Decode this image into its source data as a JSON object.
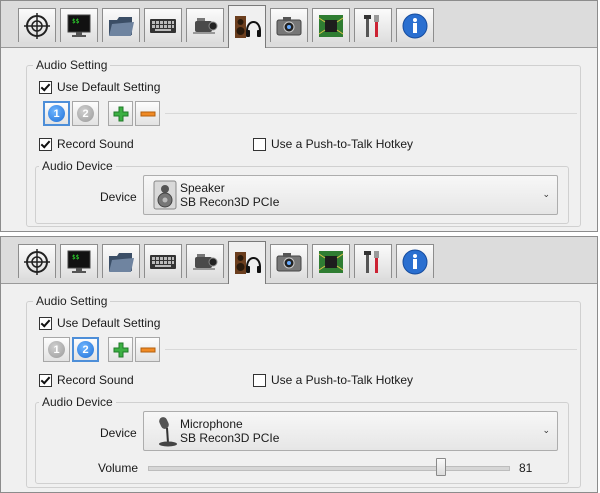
{
  "tabs": [
    {
      "name": "crosshair-icon"
    },
    {
      "name": "monitor-icon"
    },
    {
      "name": "folder-icon"
    },
    {
      "name": "keyboard-icon"
    },
    {
      "name": "camcorder-icon"
    },
    {
      "name": "speaker-headphones-icon"
    },
    {
      "name": "camera-icon"
    },
    {
      "name": "chip-board-icon"
    },
    {
      "name": "tools-icon"
    },
    {
      "name": "info-icon"
    }
  ],
  "active_tab_index": 5,
  "panels": [
    {
      "group_title": "Audio Setting",
      "use_default_label": "Use Default Setting",
      "use_default_checked": true,
      "device_buttons": [
        {
          "label": "1",
          "selected": true
        },
        {
          "label": "2",
          "selected": false
        }
      ],
      "record_sound_label": "Record Sound",
      "record_sound_checked": true,
      "push_to_talk_label": "Use a Push-to-Talk Hotkey",
      "push_to_talk_checked": false,
      "device_group_title": "Audio Device",
      "device_label": "Device",
      "device_name": "Speaker",
      "device_model": "SB Recon3D PCIe",
      "device_icon": "speaker-icon"
    },
    {
      "group_title": "Audio Setting",
      "use_default_label": "Use Default Setting",
      "use_default_checked": true,
      "device_buttons": [
        {
          "label": "1",
          "selected": false
        },
        {
          "label": "2",
          "selected": true
        }
      ],
      "record_sound_label": "Record Sound",
      "record_sound_checked": true,
      "push_to_talk_label": "Use a Push-to-Talk Hotkey",
      "push_to_talk_checked": false,
      "device_group_title": "Audio Device",
      "device_label": "Device",
      "device_name": "Microphone",
      "device_model": "SB Recon3D PCIe",
      "device_icon": "microphone-icon",
      "volume_label": "Volume",
      "volume_value": "81",
      "volume_fraction": 0.81
    }
  ]
}
